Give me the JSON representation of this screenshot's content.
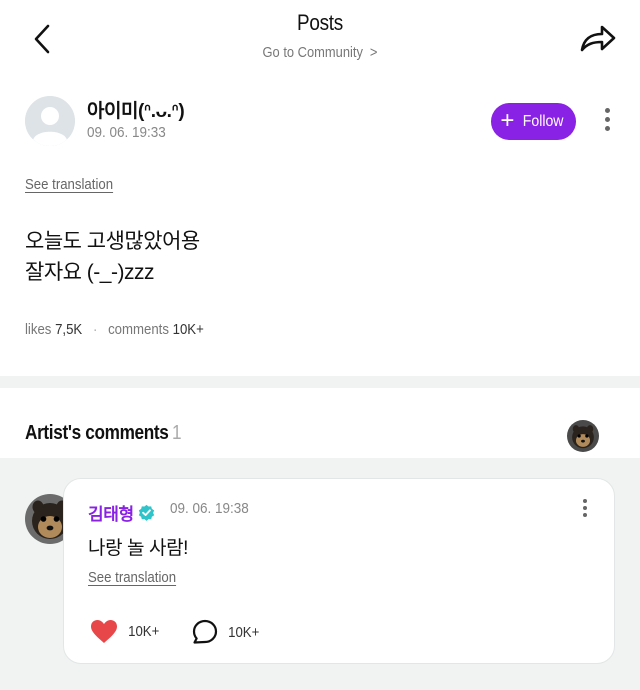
{
  "header": {
    "title": "Posts",
    "subtitle": "Go to Community",
    "subtitle_chevron": ">"
  },
  "post": {
    "author_name": "아이미(ᐢ.ᴗ.ᐢ)",
    "date": "09. 06. 19:33",
    "follow_label": "Follow",
    "follow_icon": "+",
    "see_translation": "See translation",
    "body_line1": "오늘도 고생많았어용",
    "body_line2": "잘자요 (-_-)zzz",
    "stats": {
      "likes_label": "likes",
      "likes_value": "7,5K",
      "separator": "·",
      "comments_label": "comments",
      "comments_value": "10K+"
    }
  },
  "artist_comments": {
    "title": "Artist's comments",
    "count": "1"
  },
  "comment": {
    "name": "김태형",
    "date": "09. 06. 19:38",
    "text": "나랑 놀 사람!",
    "see_translation": "See translation",
    "likes": "10K+",
    "replies": "10K+"
  },
  "colors": {
    "accent": "#8a22e6",
    "heart": "#e8474a",
    "verified": "#2fc4c9",
    "band": "#f1f3f3"
  },
  "icons": [
    "back-icon",
    "share-icon",
    "more-vertical-icon",
    "plus-icon",
    "verified-badge-icon",
    "heart-icon",
    "comment-bubble-icon"
  ]
}
